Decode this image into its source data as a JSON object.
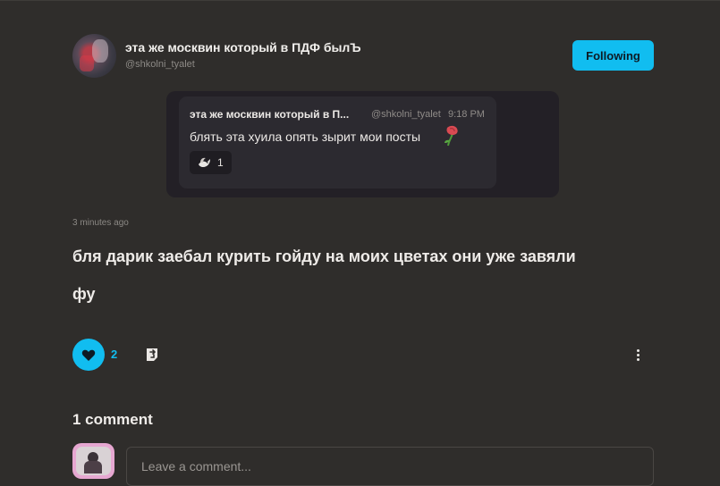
{
  "post": {
    "author": {
      "name": "эта же москвин который в ПДФ былЪ",
      "handle": "@shkolni_tyalet"
    },
    "follow_label": "Following",
    "quoted": {
      "name": "эта же москвин который в П...",
      "handle": "@shkolni_tyalet",
      "time": "9:18 PM",
      "text": "блять эта хуила опять зырит мои посты",
      "emoji": "wilted-rose",
      "reaction": {
        "icon": "dove-icon",
        "count": "1"
      }
    },
    "timestamp": "3 minutes ago",
    "body_line1": "бля дарик заебал курить гойду на моих цветах они уже завяли",
    "body_line2": "фу",
    "likes": "2",
    "accent": "#11bdf0"
  },
  "comments": {
    "title": "1 comment",
    "placeholder": "Leave a comment..."
  }
}
